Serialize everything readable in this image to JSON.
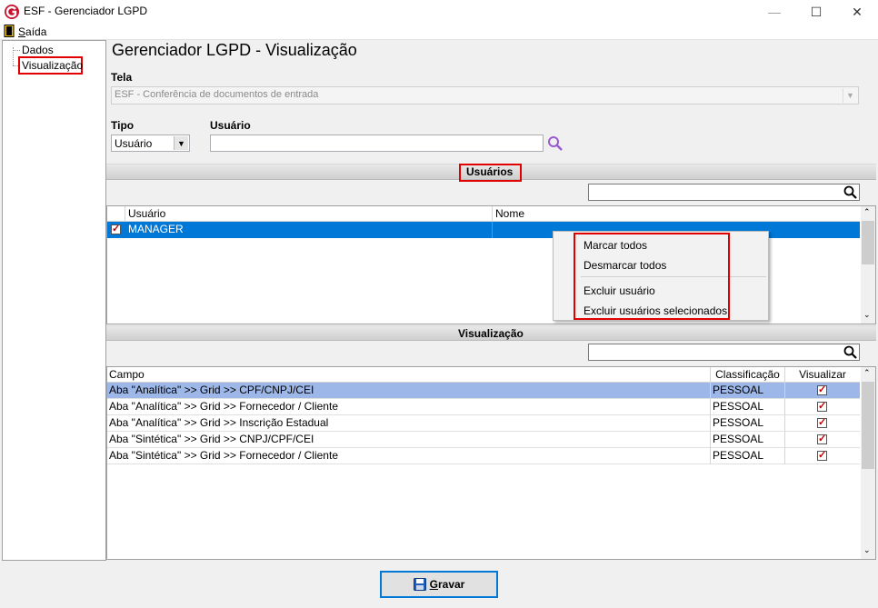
{
  "window": {
    "title": "ESF - Gerenciador LGPD",
    "minimize": "—",
    "maximize": "☐",
    "close": "✕"
  },
  "menu": {
    "saida_prefix": "S",
    "saida_rest": "aída"
  },
  "tree": {
    "items": [
      {
        "label": "Dados"
      },
      {
        "label": "Visualização"
      }
    ]
  },
  "page_title": "Gerenciador LGPD - Visualização",
  "tela": {
    "label": "Tela",
    "value": "ESF - Conferência de documentos de entrada"
  },
  "tipo": {
    "label": "Tipo",
    "value": "Usuário"
  },
  "usuario_field": {
    "label": "Usuário",
    "value": ""
  },
  "usuarios_section": {
    "title": "Usuários",
    "search_value": "",
    "columns": [
      "Usuário",
      "Nome"
    ],
    "rows": [
      {
        "checked": true,
        "usuario": "MANAGER",
        "nome": ""
      }
    ]
  },
  "context_menu": {
    "items": [
      "Marcar todos",
      "Desmarcar todos",
      "Excluir usuário",
      "Excluir usuários selecionados"
    ]
  },
  "visualizacao_section": {
    "title": "Visualização",
    "search_value": "",
    "columns": [
      "Campo",
      "Classificação",
      "Visualizar"
    ],
    "rows": [
      {
        "campo": "Aba \"Analítica\" >> Grid >> CPF/CNPJ/CEI",
        "classificacao": "PESSOAL",
        "visualizar": true
      },
      {
        "campo": "Aba \"Analítica\" >> Grid >> Fornecedor / Cliente",
        "classificacao": "PESSOAL",
        "visualizar": true
      },
      {
        "campo": "Aba \"Analítica\" >> Grid >> Inscrição Estadual",
        "classificacao": "PESSOAL",
        "visualizar": true
      },
      {
        "campo": "Aba \"Sintética\" >> Grid >>  CNPJ/CPF/CEI",
        "classificacao": "PESSOAL",
        "visualizar": true
      },
      {
        "campo": "Aba \"Sintética\" >> Grid >> Fornecedor / Cliente",
        "classificacao": "PESSOAL",
        "visualizar": true
      }
    ]
  },
  "gravar_button": {
    "underlined": "G",
    "rest": "ravar"
  },
  "colors": {
    "selection": "#0078d7",
    "row_highlight": "#9db7e8",
    "accent_red": "#e00000"
  }
}
